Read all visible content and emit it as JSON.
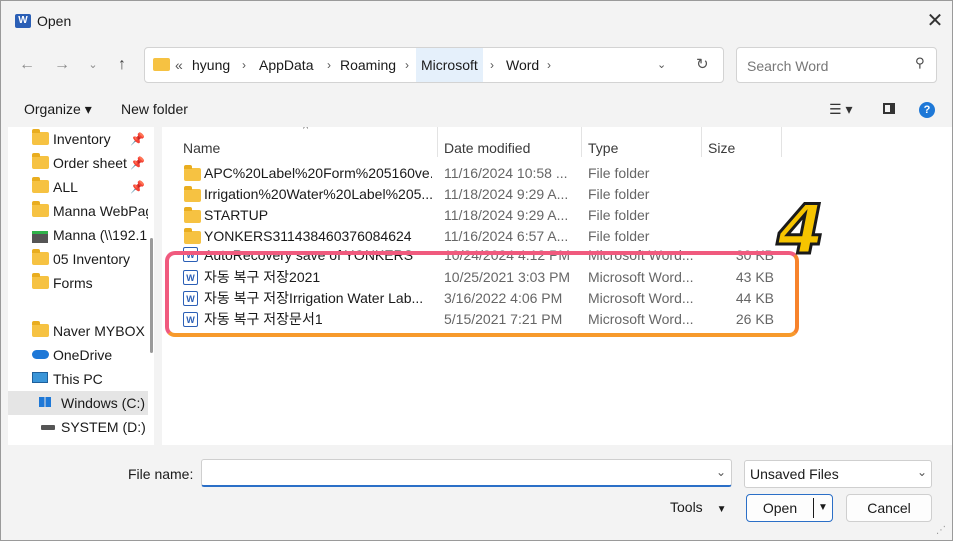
{
  "window": {
    "title": "Open",
    "app_icon": "W"
  },
  "address": {
    "overflow": "«",
    "crumbs": [
      "hyung",
      "AppData",
      "Roaming",
      "Microsoft",
      "Word"
    ]
  },
  "search": {
    "placeholder": "Search Word"
  },
  "toolbar": {
    "organize": "Organize ▾",
    "new_folder": "New folder"
  },
  "nav": [
    {
      "label": "Inventory",
      "pinned": true
    },
    {
      "label": "Order sheet",
      "pinned": true
    },
    {
      "label": "ALL",
      "pinned": true
    },
    {
      "label": "Manna WebPag"
    },
    {
      "label": "Manna (\\\\192.1"
    },
    {
      "label": "05 Inventory"
    },
    {
      "label": "Forms"
    },
    {
      "label": "Naver MYBOX"
    },
    {
      "label": "OneDrive"
    },
    {
      "label": "This PC"
    },
    {
      "label": "Windows (C:)"
    },
    {
      "label": "SYSTEM  (D:)"
    }
  ],
  "columns": {
    "name": "Name",
    "date": "Date modified",
    "type": "Type",
    "size": "Size"
  },
  "files": [
    {
      "name": "APC%20Label%20Form%205160ve...",
      "date": "11/16/2024 10:58 ...",
      "type": "File folder",
      "size": "",
      "icon": "folder-icon"
    },
    {
      "name": "Irrigation%20Water%20Label%205...",
      "date": "11/18/2024 9:29 A...",
      "type": "File folder",
      "size": "",
      "icon": "folder-icon"
    },
    {
      "name": "STARTUP",
      "date": "11/18/2024 9:29 A...",
      "type": "File folder",
      "size": "",
      "icon": "folder-icon"
    },
    {
      "name": "YONKERS311438460376084624",
      "date": "11/16/2024 6:57 A...",
      "type": "File folder",
      "size": "",
      "icon": "folder-icon"
    },
    {
      "name": "AutoRecovery save of YONKERS",
      "date": "10/24/2024 4:12 PM",
      "type": "Microsoft Word...",
      "size": "30 KB",
      "icon": "word-doc-icon"
    },
    {
      "name": "자동 복구 저장2021",
      "date": "10/25/2021 3:03 PM",
      "type": "Microsoft Word...",
      "size": "43 KB",
      "icon": "word-doc-icon"
    },
    {
      "name": "자동 복구 저장Irrigation Water Lab...",
      "date": "3/16/2022 4:06 PM",
      "type": "Microsoft Word...",
      "size": "44 KB",
      "icon": "word-doc-icon"
    },
    {
      "name": "자동 복구 저장문서1",
      "date": "5/15/2021 7:21 PM",
      "type": "Microsoft Word...",
      "size": "26 KB",
      "icon": "word-doc-icon"
    }
  ],
  "annotation": {
    "number": "4",
    "color": "#f6c400",
    "box_color": "#f05a7e"
  },
  "bottom": {
    "file_name_label": "File name:",
    "file_name_value": "",
    "filter": "Unsaved Files",
    "tools": "Tools",
    "open": "Open",
    "cancel": "Cancel"
  }
}
